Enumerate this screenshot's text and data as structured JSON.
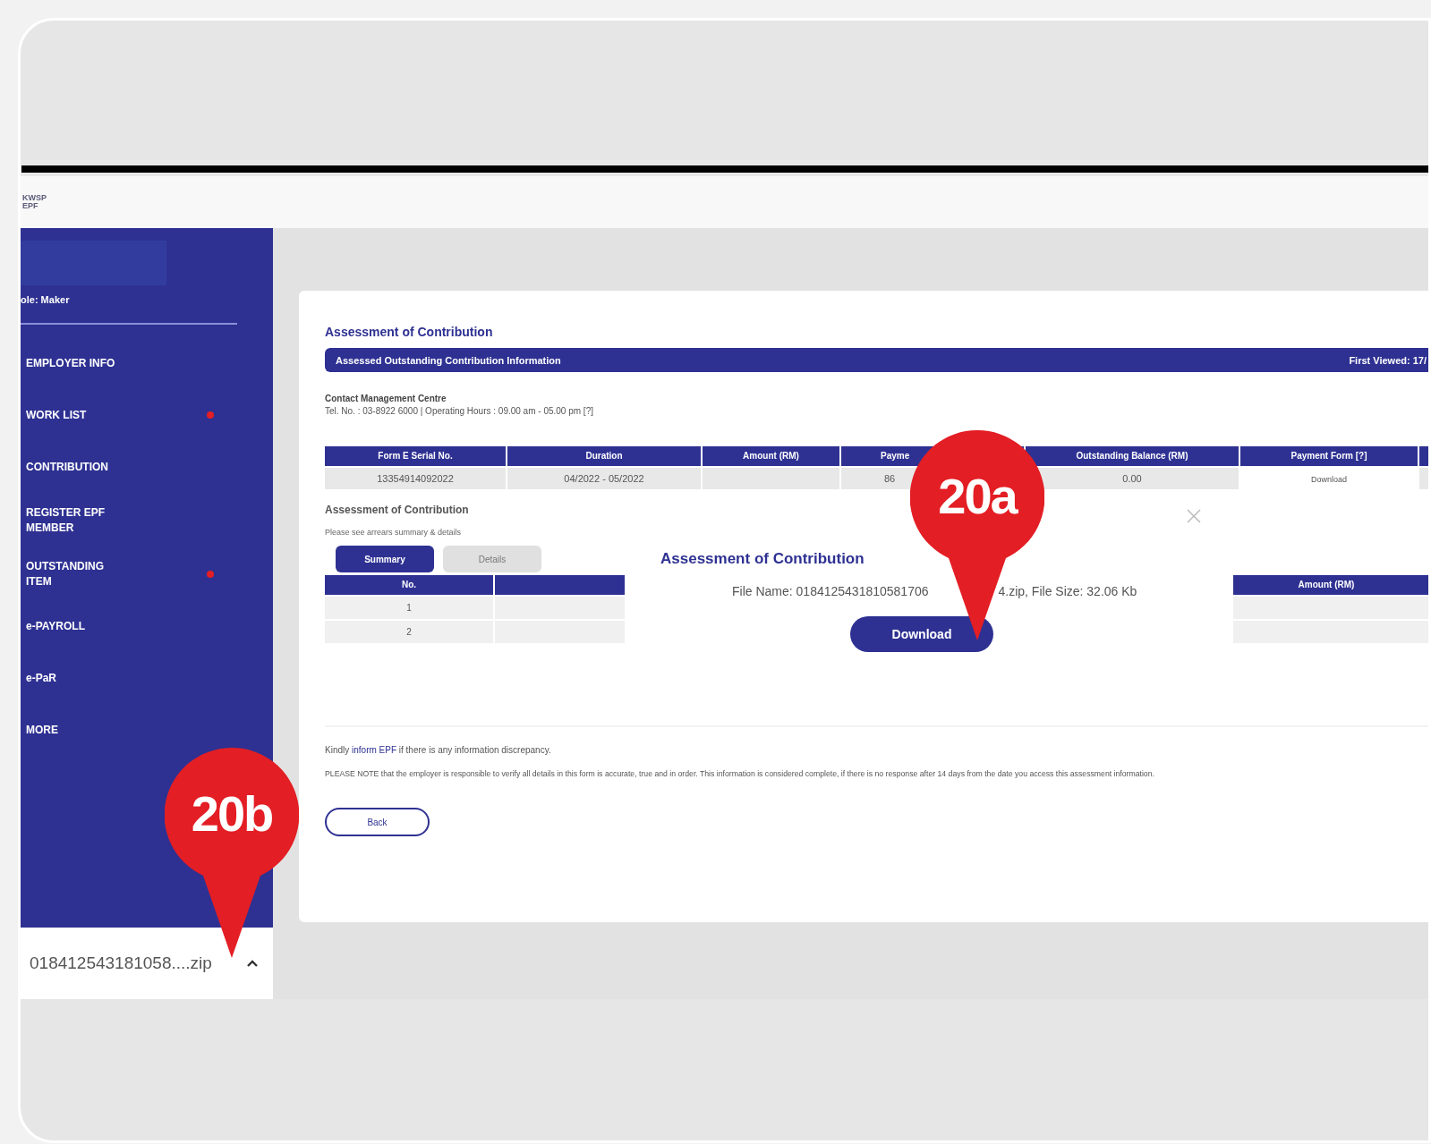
{
  "header": {
    "logo_lines": [
      "KWSP",
      "EPF"
    ]
  },
  "sidebar": {
    "role": "ole: Maker",
    "items": [
      {
        "label": "EMPLOYER INFO",
        "alert": false
      },
      {
        "label": "WORK LIST",
        "alert": true
      },
      {
        "label": "CONTRIBUTION",
        "alert": false
      },
      {
        "label": "REGISTER EPF MEMBER",
        "alert": false
      },
      {
        "label": "OUTSTANDING ITEM",
        "alert": true
      },
      {
        "label": "e-PAYROLL",
        "alert": false
      },
      {
        "label": "e-PaR",
        "alert": false
      },
      {
        "label": "MORE",
        "alert": false
      }
    ]
  },
  "download_bar": {
    "file": "018412543181058....zip"
  },
  "page": {
    "title": "Assessment of Contribution",
    "banner": {
      "title": "Assessed Outstanding Contribution Information",
      "first_viewed": "First Viewed: 17/"
    },
    "contact": {
      "title": "Contact Management Centre",
      "line": "Tel. No. : 03-8922 6000 | Operating Hours : 09.00 am - 05.00 pm [?]"
    },
    "table": {
      "columns": [
        "Form E Serial No.",
        "Duration",
        "Amount (RM)",
        "Payme",
        "Outstanding Balance (RM)",
        "Payment Form [?]",
        ""
      ],
      "rows": [
        {
          "cells": [
            "13354914092022",
            "04/2022 - 05/2022",
            "",
            "86",
            "0.00"
          ],
          "link": "Download"
        }
      ]
    },
    "section": {
      "title": "Assessment of Contribution",
      "hint": "Please see arrears summary & details"
    },
    "tabs": [
      {
        "label": "Summary",
        "selected": true
      },
      {
        "label": "Details",
        "selected": false
      }
    ],
    "summary_table": {
      "columns": [
        "No.",
        "",
        "Amount (RM)"
      ],
      "rows": [
        [
          "1",
          "",
          ""
        ],
        [
          "2",
          "",
          ""
        ]
      ]
    },
    "notice": {
      "before": "Kindly",
      "link": "inform EPF",
      "after": "if there is any information discrepancy."
    },
    "note": "PLEASE NOTE that the employer is responsible to verify all details in this form is accurate, true and in order. This information is considered complete, if there is no response after 14 days from the date you access this assessment information.",
    "back": "Back"
  },
  "modal": {
    "title": "Assessment of Contribution",
    "file_name": "File Name: 0184125431810581706",
    "file_rest": "4.zip, File Size: 32.06 Kb",
    "button": "Download"
  },
  "callouts": [
    {
      "label": "20a"
    },
    {
      "label": "20b"
    }
  ]
}
